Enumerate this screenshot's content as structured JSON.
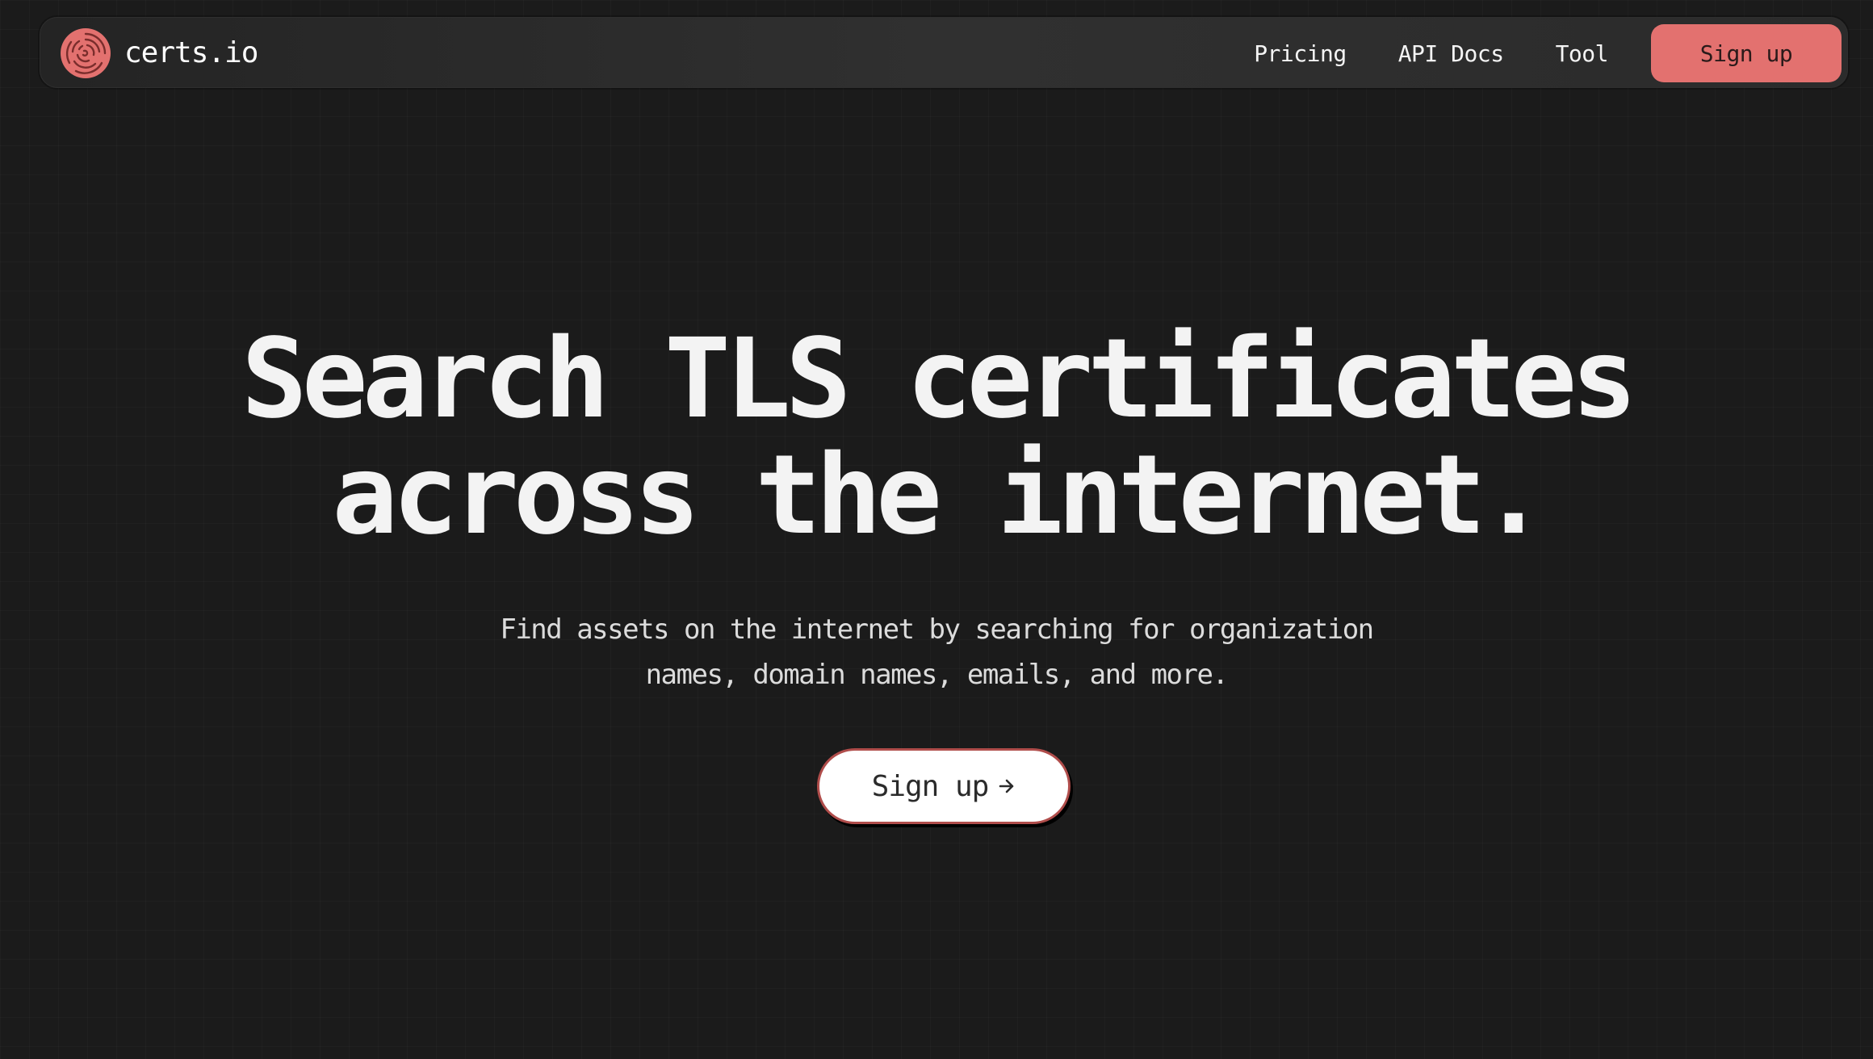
{
  "brand": {
    "name": "certs.io",
    "logo_icon": "concentric-swirl-logo",
    "accent_color": "#e3716f"
  },
  "nav": {
    "links": [
      "Pricing",
      "API Docs",
      "Tool"
    ],
    "signup_label": "Sign up"
  },
  "hero": {
    "title_line1": "Search TLS certificates",
    "title_line2": "across the internet.",
    "subtitle_line1": "Find assets on the internet by searching for organization",
    "subtitle_line2": "names, domain names, emails, and more.",
    "cta_label": "Sign up",
    "cta_icon": "arrow-right-icon"
  },
  "colors": {
    "background": "#1b1b1b",
    "navbar": "#2c2c2c",
    "cta_background": "#ffffff",
    "cta_border": "#b04d4b"
  }
}
